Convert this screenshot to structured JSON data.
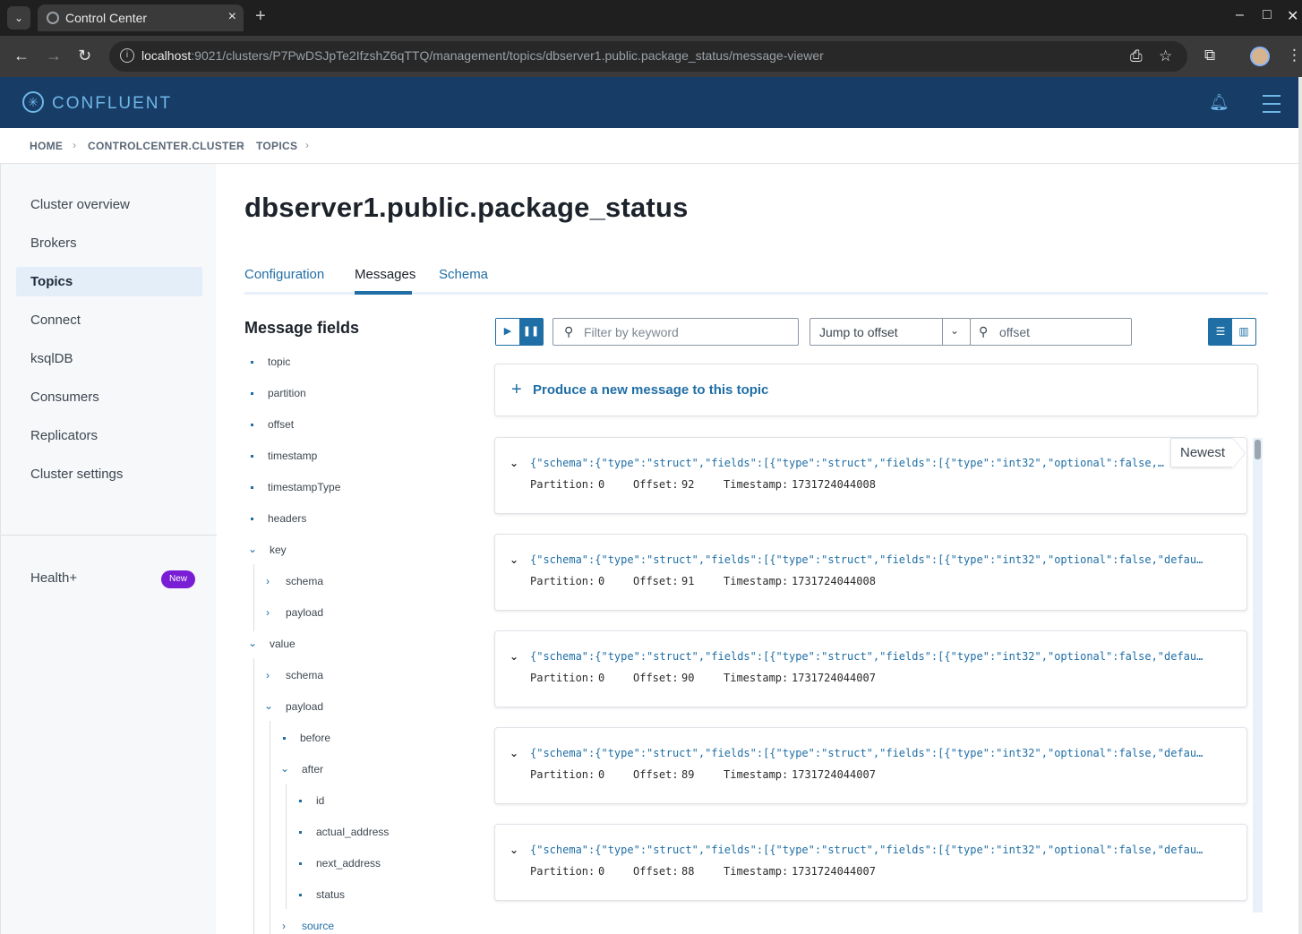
{
  "browser": {
    "tab_title": "Control Center",
    "url_host": "localhost",
    "url_rest": ":9021/clusters/P7PwDSJpTe2IfzshZ6qTTQ/management/topics/dbserver1.public.package_status/message-viewer"
  },
  "header": {
    "logo_text": "CONFLUENT"
  },
  "breadcrumb": [
    "HOME",
    "CONTROLCENTER.CLUSTER",
    "TOPICS"
  ],
  "sidebar": {
    "items": [
      {
        "label": "Cluster overview"
      },
      {
        "label": "Brokers"
      },
      {
        "label": "Topics",
        "active": true
      },
      {
        "label": "Connect"
      },
      {
        "label": "ksqlDB"
      },
      {
        "label": "Consumers"
      },
      {
        "label": "Replicators"
      },
      {
        "label": "Cluster settings"
      }
    ],
    "health": {
      "label": "Health+",
      "badge": "New"
    }
  },
  "page": {
    "title": "dbserver1.public.package_status",
    "tabs": [
      {
        "label": "Configuration"
      },
      {
        "label": "Messages",
        "active": true
      },
      {
        "label": "Schema"
      }
    ]
  },
  "fields": {
    "title": "Message fields",
    "items": [
      "topic",
      "partition",
      "offset",
      "timestamp",
      "timestampType",
      "headers",
      "key",
      "schema",
      "payload",
      "value",
      "schema",
      "payload",
      "before",
      "after",
      "id",
      "actual_address",
      "next_address",
      "status",
      "source"
    ]
  },
  "controls": {
    "filter_placeholder": "Filter by keyword",
    "jump_select": "Jump to offset",
    "offset_placeholder": "offset"
  },
  "produce": {
    "label": "Produce a new message to this topic"
  },
  "newest_label": "Newest",
  "messages": {
    "partition_label": "Partition:",
    "offset_label": "Offset:",
    "timestamp_label": "Timestamp:",
    "items": [
      {
        "json": "{\"schema\":{\"type\":\"struct\",\"fields\":[{\"type\":\"struct\",\"fields\":[{\"type\":\"int32\",\"optional\":false,\"defau…",
        "partition": "0",
        "offset": "92",
        "timestamp": "1731724044008"
      },
      {
        "json": "{\"schema\":{\"type\":\"struct\",\"fields\":[{\"type\":\"struct\",\"fields\":[{\"type\":\"int32\",\"optional\":false,\"defau…",
        "partition": "0",
        "offset": "91",
        "timestamp": "1731724044008"
      },
      {
        "json": "{\"schema\":{\"type\":\"struct\",\"fields\":[{\"type\":\"struct\",\"fields\":[{\"type\":\"int32\",\"optional\":false,\"defau…",
        "partition": "0",
        "offset": "90",
        "timestamp": "1731724044007"
      },
      {
        "json": "{\"schema\":{\"type\":\"struct\",\"fields\":[{\"type\":\"struct\",\"fields\":[{\"type\":\"int32\",\"optional\":false,\"defau…",
        "partition": "0",
        "offset": "89",
        "timestamp": "1731724044007"
      },
      {
        "json": "{\"schema\":{\"type\":\"struct\",\"fields\":[{\"type\":\"struct\",\"fields\":[{\"type\":\"int32\",\"optional\":false,\"defau…",
        "partition": "0",
        "offset": "88",
        "timestamp": "1731724044007"
      }
    ]
  },
  "colors": {
    "brand_header": "#173c66",
    "accent": "#1f6ea5",
    "badge": "#7a1ed6"
  }
}
